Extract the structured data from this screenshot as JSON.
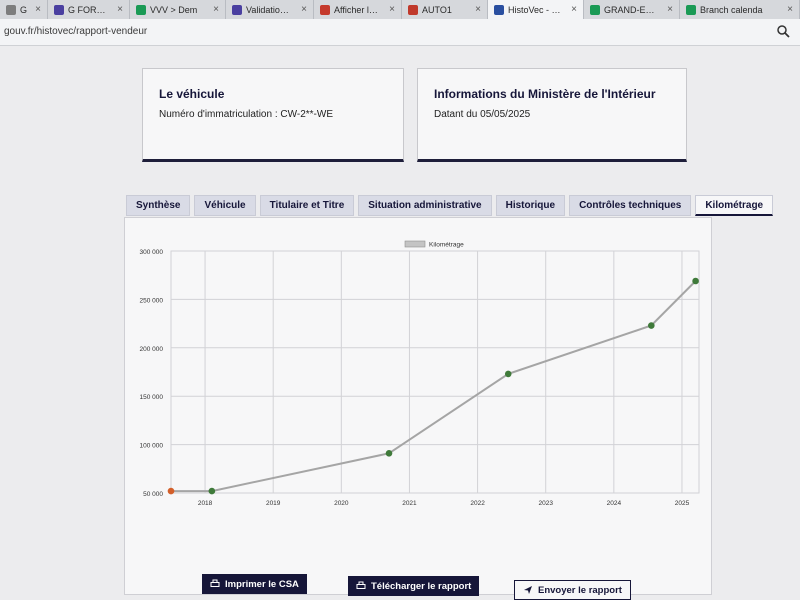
{
  "browser": {
    "tabs": [
      {
        "title": "Group",
        "color": "#7d7d7d"
      },
      {
        "title": "G FORM Contr",
        "color": "#4a3fa0"
      },
      {
        "title": "VVV > Dem",
        "color": "#1a9a55"
      },
      {
        "title": "Validations Qu",
        "color": "#4a3fa0"
      },
      {
        "title": "Afficher le véh",
        "color": "#c53a2d"
      },
      {
        "title": "AUTO1",
        "color": "#c0392b"
      },
      {
        "title": "HistoVec - Rap",
        "color": "#2a4fa0",
        "active": true
      },
      {
        "title": "GRAND-EST - ",
        "color": "#1a9a55"
      },
      {
        "title": "Branch calenda",
        "color": "#1a9a55"
      }
    ],
    "url": "gouv.fr/histovec/rapport-vendeur"
  },
  "vehicle_card": {
    "title": "Le véhicule",
    "plate": "Numéro d'immatriculation : CW-2**-WE"
  },
  "ministry_card": {
    "title": "Informations du Ministère de l'Intérieur",
    "date": "Datant du 05/05/2025"
  },
  "tabs": [
    "Synthèse",
    "Véhicule",
    "Titulaire et Titre",
    "Situation administrative",
    "Historique",
    "Contrôles techniques",
    "Kilométrage"
  ],
  "active_tab": "Kilométrage",
  "chart_data": {
    "type": "line",
    "legend": "Kilométrage",
    "x_ticks": [
      "2018",
      "2019",
      "2020",
      "2021",
      "2022",
      "2023",
      "2024",
      "2025"
    ],
    "y_ticks": [
      "50 000",
      "100 000",
      "150 000",
      "200 000",
      "250 000",
      "300 000"
    ],
    "ylim": [
      50000,
      300000
    ],
    "xlim": [
      2017.5,
      2025.25
    ],
    "series": [
      {
        "name": "Kilométrage",
        "color": "#a5a5a5",
        "points": [
          {
            "x": 2017.5,
            "y": 52000,
            "color": "#d35f2a"
          },
          {
            "x": 2018.1,
            "y": 52000,
            "color": "#3f7a3a"
          },
          {
            "x": 2020.7,
            "y": 91000,
            "color": "#3f7a3a"
          },
          {
            "x": 2022.45,
            "y": 173000,
            "color": "#3f7a3a"
          },
          {
            "x": 2024.55,
            "y": 223000,
            "color": "#3f7a3a"
          },
          {
            "x": 2025.2,
            "y": 269000,
            "color": "#3f7a3a"
          }
        ]
      }
    ]
  },
  "buttons": {
    "print": "Imprimer le CSA",
    "download": "Télécharger le rapport",
    "send": "Envoyer le rapport"
  }
}
